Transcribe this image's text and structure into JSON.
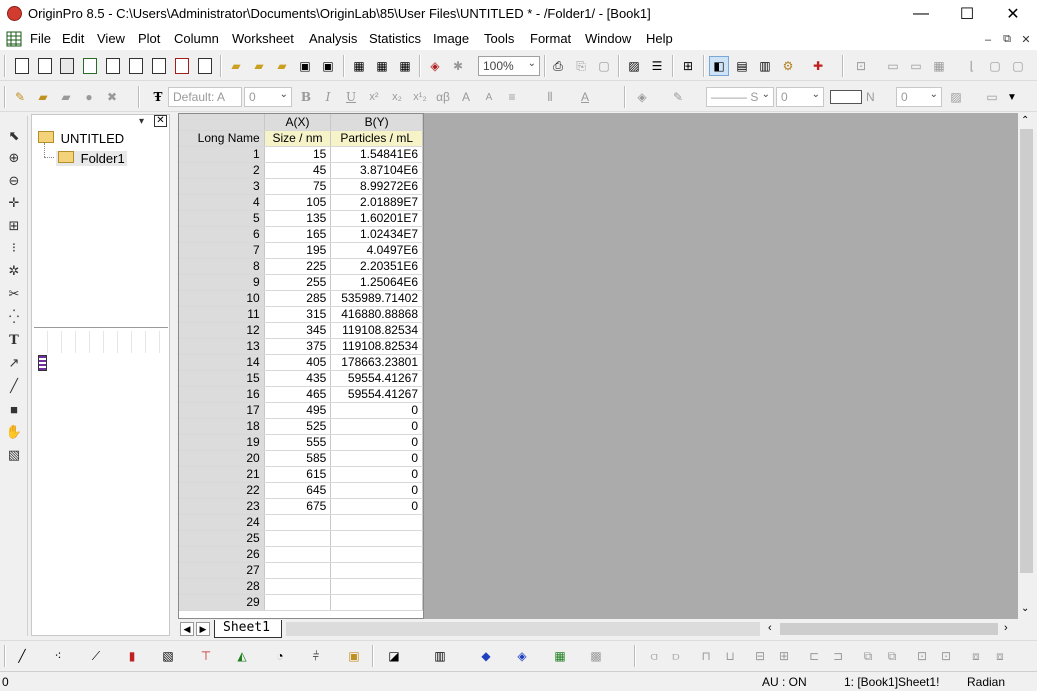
{
  "window": {
    "title": "OriginPro 8.5 - C:\\Users\\Administrator\\Documents\\OriginLab\\85\\User Files\\UNTITLED * - /Folder1/ - [Book1]",
    "minimize": "—",
    "maximize": "☐",
    "close": "✕"
  },
  "menu": [
    "File",
    "Edit",
    "View",
    "Plot",
    "Column",
    "Worksheet",
    "Analysis",
    "Statistics",
    "Image",
    "Tools",
    "Format",
    "Window",
    "Help"
  ],
  "mdi_buttons": [
    "–",
    "⧉",
    "✕"
  ],
  "toolbar1": {
    "zoom": "100%"
  },
  "toolbar2": {
    "font_combo": "Default: A",
    "font_size": "0",
    "line_style": "S",
    "line_width": "0",
    "fill_label": "N",
    "fill_value": "0"
  },
  "project_explorer": {
    "root": "UNTITLED",
    "folder": "Folder1"
  },
  "worksheet": {
    "columns": [
      {
        "name": "A(X)",
        "long_name": "Size / nm"
      },
      {
        "name": "B(Y)",
        "long_name": "Particles / mL"
      }
    ],
    "long_name_label": "Long Name",
    "rows": [
      [
        "1",
        "15",
        "1.54841E6"
      ],
      [
        "2",
        "45",
        "3.87104E6"
      ],
      [
        "3",
        "75",
        "8.99272E6"
      ],
      [
        "4",
        "105",
        "2.01889E7"
      ],
      [
        "5",
        "135",
        "1.60201E7"
      ],
      [
        "6",
        "165",
        "1.02434E7"
      ],
      [
        "7",
        "195",
        "4.0497E6"
      ],
      [
        "8",
        "225",
        "2.20351E6"
      ],
      [
        "9",
        "255",
        "1.25064E6"
      ],
      [
        "10",
        "285",
        "535989.71402"
      ],
      [
        "11",
        "315",
        "416880.88868"
      ],
      [
        "12",
        "345",
        "119108.82534"
      ],
      [
        "13",
        "375",
        "119108.82534"
      ],
      [
        "14",
        "405",
        "178663.23801"
      ],
      [
        "15",
        "435",
        "59554.41267"
      ],
      [
        "16",
        "465",
        "59554.41267"
      ],
      [
        "17",
        "495",
        "0"
      ],
      [
        "18",
        "525",
        "0"
      ],
      [
        "19",
        "555",
        "0"
      ],
      [
        "20",
        "585",
        "0"
      ],
      [
        "21",
        "615",
        "0"
      ],
      [
        "22",
        "645",
        "0"
      ],
      [
        "23",
        "675",
        "0"
      ],
      [
        "24",
        "",
        ""
      ],
      [
        "25",
        "",
        ""
      ],
      [
        "26",
        "",
        ""
      ],
      [
        "27",
        "",
        ""
      ],
      [
        "28",
        "",
        ""
      ],
      [
        "29",
        "",
        ""
      ]
    ],
    "sheet_tab": "Sheet1"
  },
  "status": {
    "left": "0",
    "au": "AU : ON",
    "ref": "1: [Book1]Sheet1!",
    "angle": "Radian"
  },
  "colors": {
    "long_name_row": "#f6f3c9",
    "header_grey": "#dcdcdc",
    "mdi_background": "#ababab",
    "accent_red": "#d23b2f"
  }
}
